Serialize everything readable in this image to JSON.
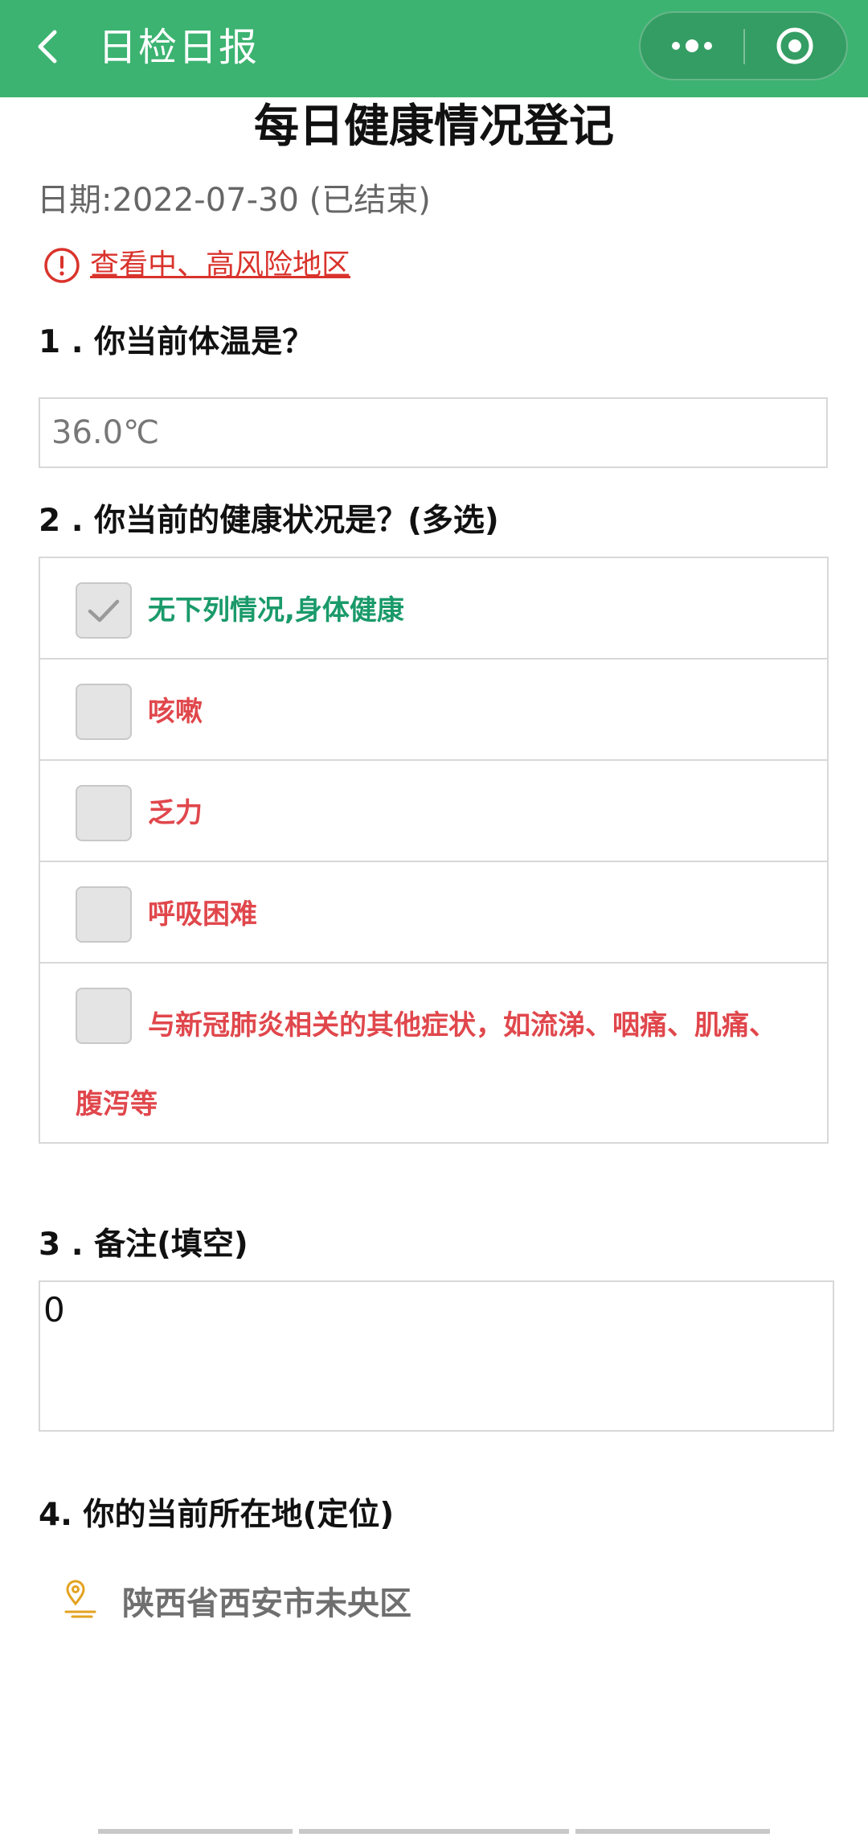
{
  "header": {
    "title": "日检日报",
    "back_icon": "chevron-left-icon",
    "more_icon": "more-dots-icon",
    "close_icon": "target-close-icon",
    "bg_color": "#3cb371"
  },
  "form": {
    "title": "每日健康情况登记",
    "date_line": "日期:2022-07-30 (已结束)",
    "risk_link": "查看中、高风险地区",
    "q1": {
      "label": "1 . 你当前体温是？",
      "value": "36.0℃"
    },
    "q2": {
      "label": "2 . 你当前的健康状况是？(多选)",
      "options": [
        {
          "label": "无下列情况,身体健康",
          "checked": true
        },
        {
          "label": "咳嗽",
          "checked": false
        },
        {
          "label": "乏力",
          "checked": false
        },
        {
          "label": "呼吸困难",
          "checked": false
        },
        {
          "label": "与新冠肺炎相关的其他症状，如流涕、咽痛、肌痛、腹泻等",
          "checked": false
        }
      ]
    },
    "q3": {
      "label": "3 . 备注(填空)",
      "value": "0"
    },
    "q4": {
      "label": "4. 你的当前所在地(定位)",
      "location": "陕西省西安市未央区"
    }
  },
  "colors": {
    "healthy": "#1a9a6a",
    "symptom": "#e0474c",
    "risk": "#d9332c"
  }
}
